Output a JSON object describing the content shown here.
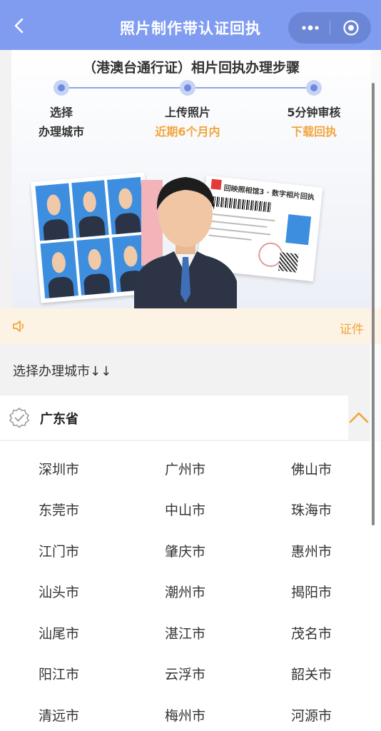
{
  "header": {
    "title": "照片制作带认证回执"
  },
  "banner": {
    "title": "（港澳台通行证）相片回执办理步骤",
    "steps": [
      {
        "line1": "选择",
        "line2": "办理城市"
      },
      {
        "line1": "上传照片",
        "line2": "近期6个月内"
      },
      {
        "line1": "5分钟审核",
        "line2": "下载回执"
      }
    ],
    "receipt_title": "回映照相馆3 · 数字相片回执"
  },
  "notice": {
    "text": "证件"
  },
  "select": {
    "title": "选择办理城市↓↓"
  },
  "province": {
    "name": "广东省"
  },
  "cities": [
    [
      "深圳市",
      "广州市",
      "佛山市"
    ],
    [
      "东莞市",
      "中山市",
      "珠海市"
    ],
    [
      "江门市",
      "肇庆市",
      "惠州市"
    ],
    [
      "汕头市",
      "潮州市",
      "揭阳市"
    ],
    [
      "汕尾市",
      "湛江市",
      "茂名市"
    ],
    [
      "阳江市",
      "云浮市",
      "韶关市"
    ],
    [
      "清远市",
      "梅州市",
      "河源市"
    ]
  ],
  "colors": {
    "header": "#7f9cf0",
    "accent": "#f2a53c",
    "notice_bg": "#fdf3e4"
  },
  "icons": [
    "back-arrow-icon",
    "more-dots-icon",
    "target-icon",
    "speaker-icon",
    "badge-check-icon",
    "chevron-up-icon"
  ]
}
